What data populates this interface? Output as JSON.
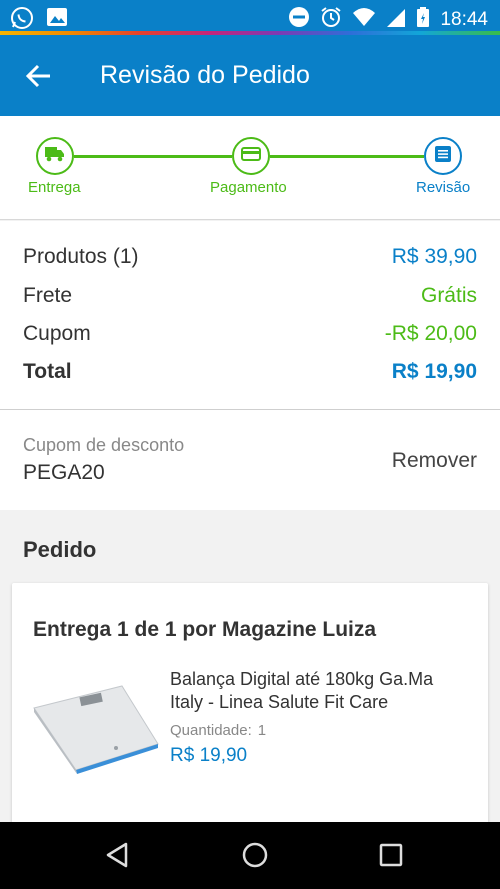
{
  "status_bar": {
    "time": "18:44",
    "left_icons": [
      "whatsapp-icon",
      "gallery-icon"
    ],
    "right_icons": [
      "do-not-disturb-icon",
      "alarm-icon",
      "wifi-icon",
      "signal-icon",
      "battery-icon"
    ]
  },
  "app_bar": {
    "title": "Revisão do Pedido",
    "back_icon": "arrow-left-icon"
  },
  "stepper": {
    "steps": [
      {
        "label": "Entrega",
        "icon": "truck-icon",
        "state": "done"
      },
      {
        "label": "Pagamento",
        "icon": "card-icon",
        "state": "done"
      },
      {
        "label": "Revisão",
        "icon": "list-icon",
        "state": "active"
      }
    ],
    "colors": {
      "done": "#4cbb17",
      "active": "#0a80c8"
    }
  },
  "summary": {
    "rows": [
      {
        "label": "Produtos (1)",
        "value": "R$ 39,90"
      },
      {
        "label": "Frete",
        "value": "Grátis"
      },
      {
        "label": "Cupom",
        "value": "-R$ 20,00"
      },
      {
        "label": "Total",
        "value": "R$ 19,90"
      }
    ]
  },
  "coupon": {
    "label": "Cupom de desconto",
    "code": "PEGA20",
    "remove_label": "Remover"
  },
  "order": {
    "section_title": "Pedido",
    "delivery_title": "Entrega 1 de 1 por Magazine Luiza",
    "product": {
      "name": "Balança Digital até 180kg Ga.Ma Italy - Linea Salute Fit Care",
      "quantity_label": "Quantidade:",
      "quantity": "1",
      "price": "R$ 19,90"
    }
  },
  "nav_bar": {
    "icons": [
      "back-triangle-icon",
      "home-circle-icon",
      "recents-square-icon"
    ]
  },
  "colors": {
    "primary": "#0a80c8",
    "success": "#4cbb17"
  }
}
